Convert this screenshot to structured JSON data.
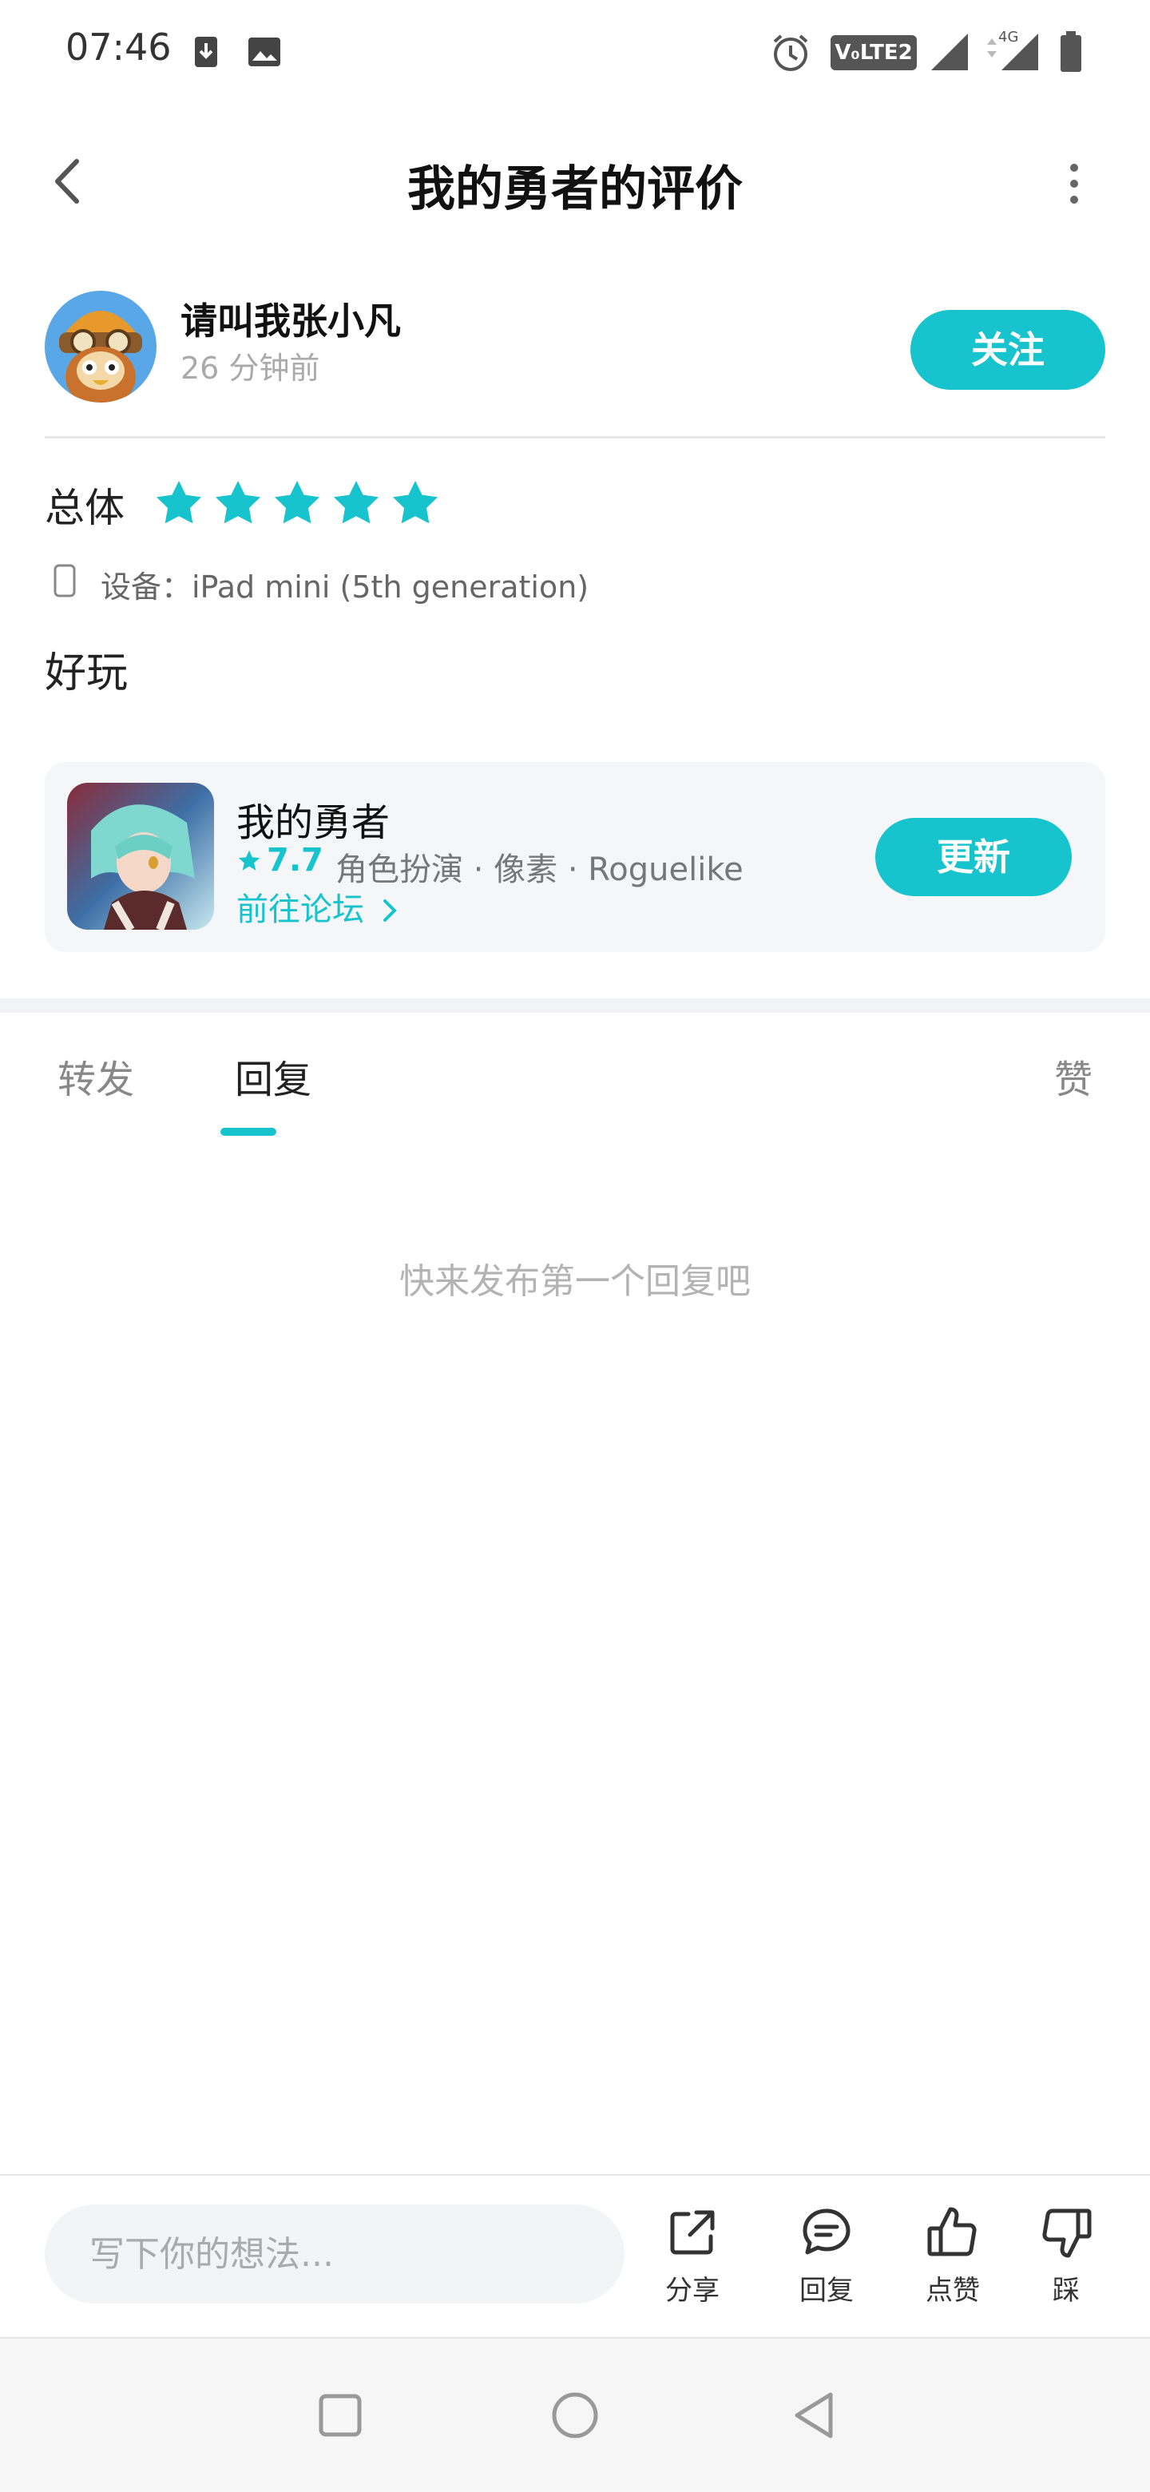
{
  "status_bar": {
    "time": "07:46",
    "icons": [
      "download-icon",
      "image-icon",
      "alarm-icon",
      "volte-icon",
      "signal-icon",
      "signal-4g-icon",
      "battery-icon"
    ],
    "volte_label": "V₀LTE2",
    "network_label": "4G"
  },
  "header": {
    "title": "我的勇者的评价",
    "back_icon": "back-arrow-icon",
    "more_icon": "more-vertical-icon"
  },
  "author": {
    "name": "请叫我张小凡",
    "time": "26 分钟前",
    "follow_label": "关注"
  },
  "review": {
    "rating_label": "总体",
    "rating": 5,
    "rating_max": 5,
    "device": "设备：iPad mini (5th generation)",
    "body": "好玩"
  },
  "game_card": {
    "name": "我的勇者",
    "score": "7.7",
    "tags": "角色扮演 · 像素 · Roguelike",
    "link": "前往论坛",
    "update_label": "更新"
  },
  "tabs": [
    {
      "label": "转发",
      "active": false
    },
    {
      "label": "回复",
      "active": true
    },
    {
      "label": "赞",
      "active": false
    }
  ],
  "empty_message": "快来发布第一个回复吧",
  "bottom_bar": {
    "input_placeholder": "写下你的想法...",
    "actions": [
      {
        "label": "分享",
        "icon": "share-icon"
      },
      {
        "label": "回复",
        "icon": "reply-icon"
      },
      {
        "label": "点赞",
        "icon": "thumbs-up-icon"
      },
      {
        "label": "踩",
        "icon": "thumbs-down-icon"
      }
    ]
  },
  "colors": {
    "accent": "#17c3cc",
    "muted_text": "#aaaaaa",
    "card_bg": "#f4f6f8"
  }
}
